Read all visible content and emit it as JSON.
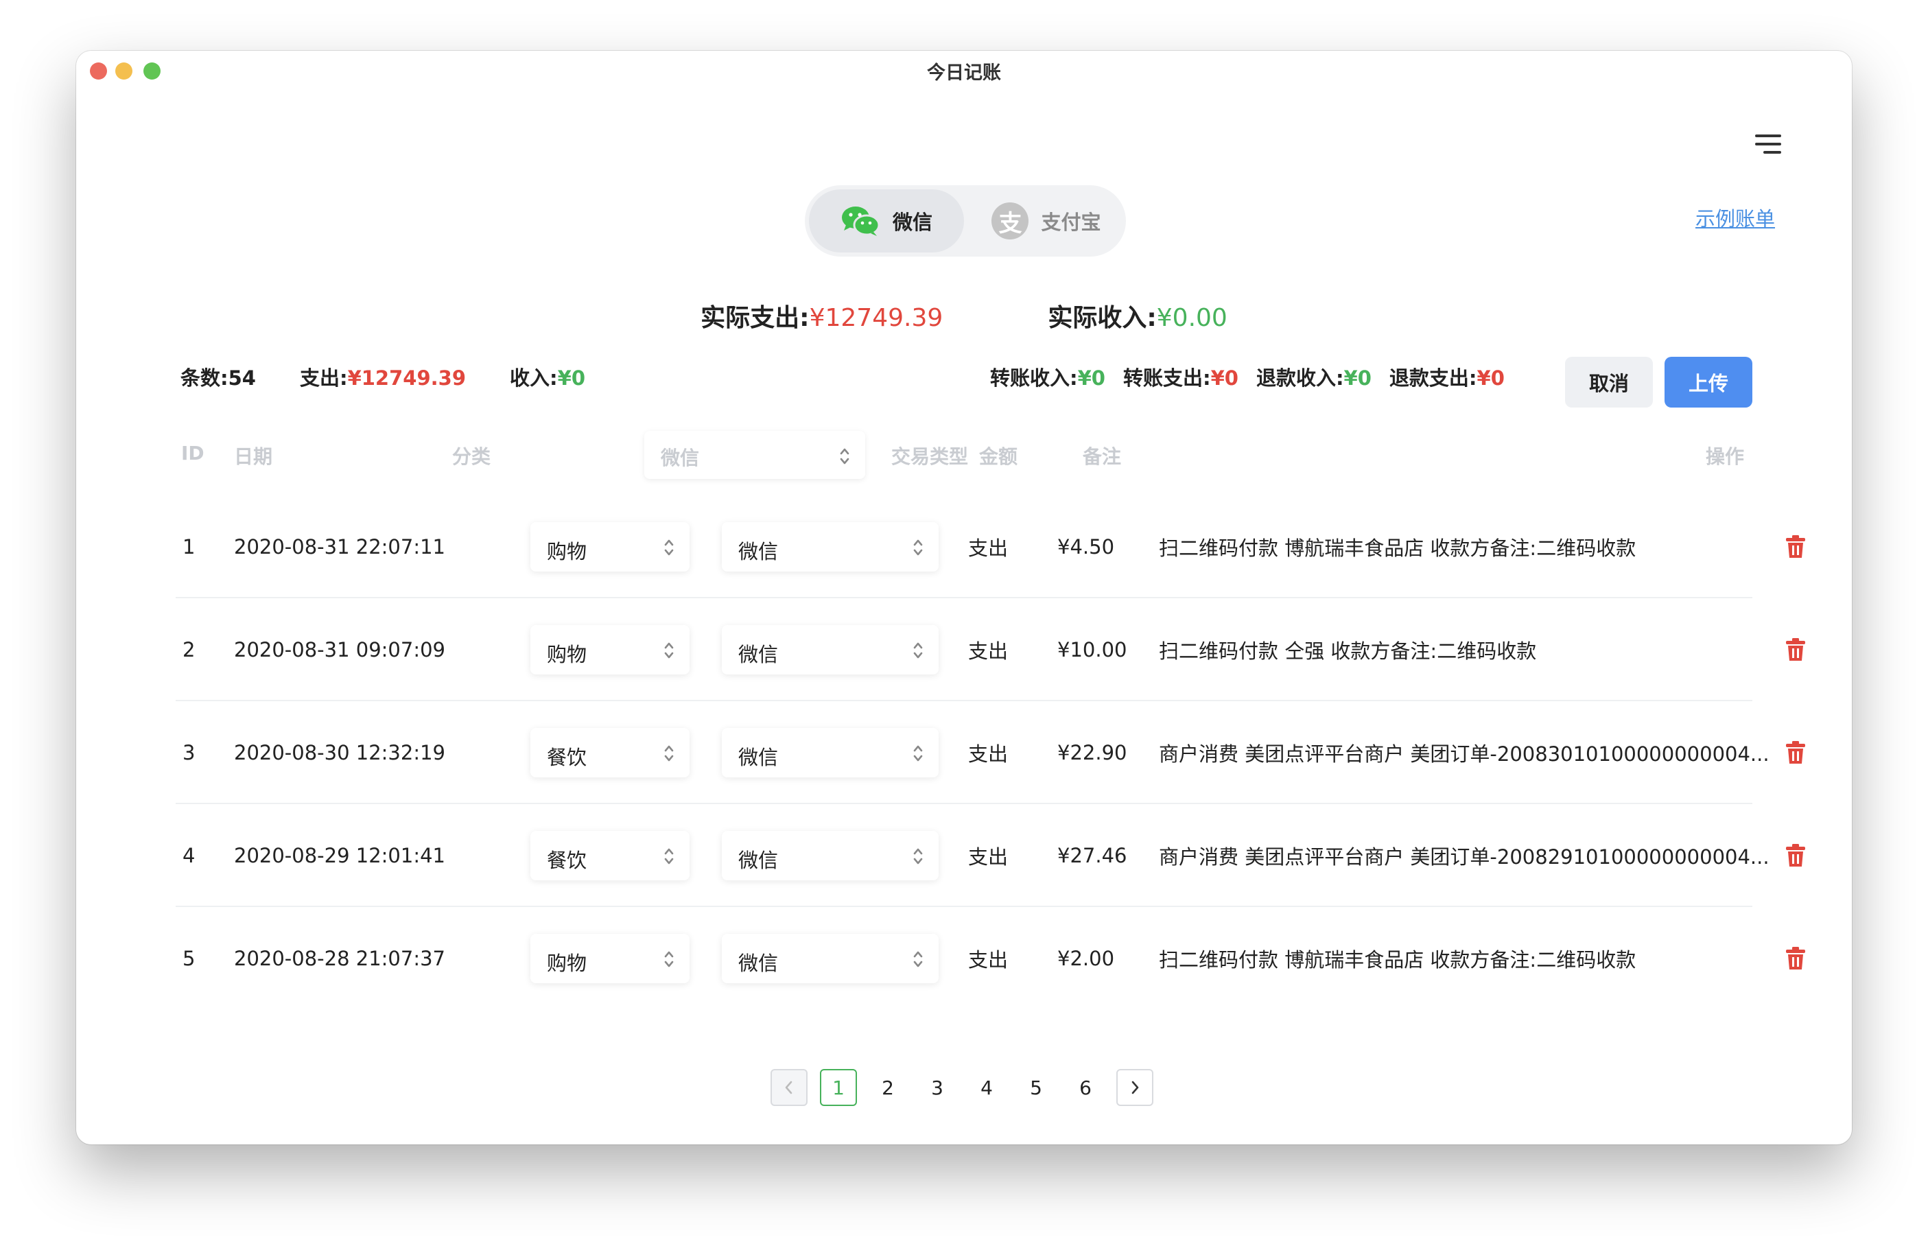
{
  "window": {
    "title": "今日记账"
  },
  "source_tabs": [
    {
      "label": "微信",
      "icon": "wechat-icon",
      "active": true
    },
    {
      "label": "支付宝",
      "icon": "alipay-icon",
      "icon_glyph": "支",
      "active": false
    }
  ],
  "example_link": "示例账单",
  "totals": {
    "expense_label": "实际支出:",
    "expense_value": "¥12749.39",
    "income_label": "实际收入:",
    "income_value": "¥0.00"
  },
  "stats": {
    "count_label": "条数:",
    "count_value": "54",
    "expense_label": "支出:",
    "expense_value": "¥12749.39",
    "income_label": "收入:",
    "income_value": "¥0",
    "transfer_in_label": "转账收入:",
    "transfer_in_value": "¥0",
    "transfer_out_label": "转账支出:",
    "transfer_out_value": "¥0",
    "refund_in_label": "退款收入:",
    "refund_in_value": "¥0",
    "refund_out_label": "退款支出:",
    "refund_out_value": "¥0"
  },
  "buttons": {
    "cancel": "取消",
    "upload": "上传"
  },
  "table": {
    "headers": {
      "id": "ID",
      "date": "日期",
      "category": "分类",
      "source_select": "微信",
      "type": "交易类型",
      "amount": "金额",
      "note": "备注",
      "action": "操作"
    },
    "rows": [
      {
        "id": "1",
        "date": "2020-08-31 22:07:11",
        "category": "购物",
        "source": "微信",
        "type": "支出",
        "amount": "¥4.50",
        "note": "扫二维码付款 博航瑞丰食品店 收款方备注:二维码收款"
      },
      {
        "id": "2",
        "date": "2020-08-31 09:07:09",
        "category": "购物",
        "source": "微信",
        "type": "支出",
        "amount": "¥10.00",
        "note": "扫二维码付款 仝强 收款方备注:二维码收款"
      },
      {
        "id": "3",
        "date": "2020-08-30 12:32:19",
        "category": "餐饮",
        "source": "微信",
        "type": "支出",
        "amount": "¥22.90",
        "note": "商户消费 美团点评平台商户 美团订单-20083010100000000004..."
      },
      {
        "id": "4",
        "date": "2020-08-29 12:01:41",
        "category": "餐饮",
        "source": "微信",
        "type": "支出",
        "amount": "¥27.46",
        "note": "商户消费 美团点评平台商户 美团订单-20082910100000000004..."
      },
      {
        "id": "5",
        "date": "2020-08-28 21:07:37",
        "category": "购物",
        "source": "微信",
        "type": "支出",
        "amount": "¥2.00",
        "note": "扫二维码付款 博航瑞丰食品店 收款方备注:二维码收款"
      }
    ]
  },
  "pagination": {
    "pages": [
      "1",
      "2",
      "3",
      "4",
      "5",
      "6"
    ],
    "current": "1"
  },
  "colors": {
    "expense": "#e1473d",
    "income": "#47b25b",
    "primary": "#4f8ef0",
    "link": "#4a90e2"
  }
}
